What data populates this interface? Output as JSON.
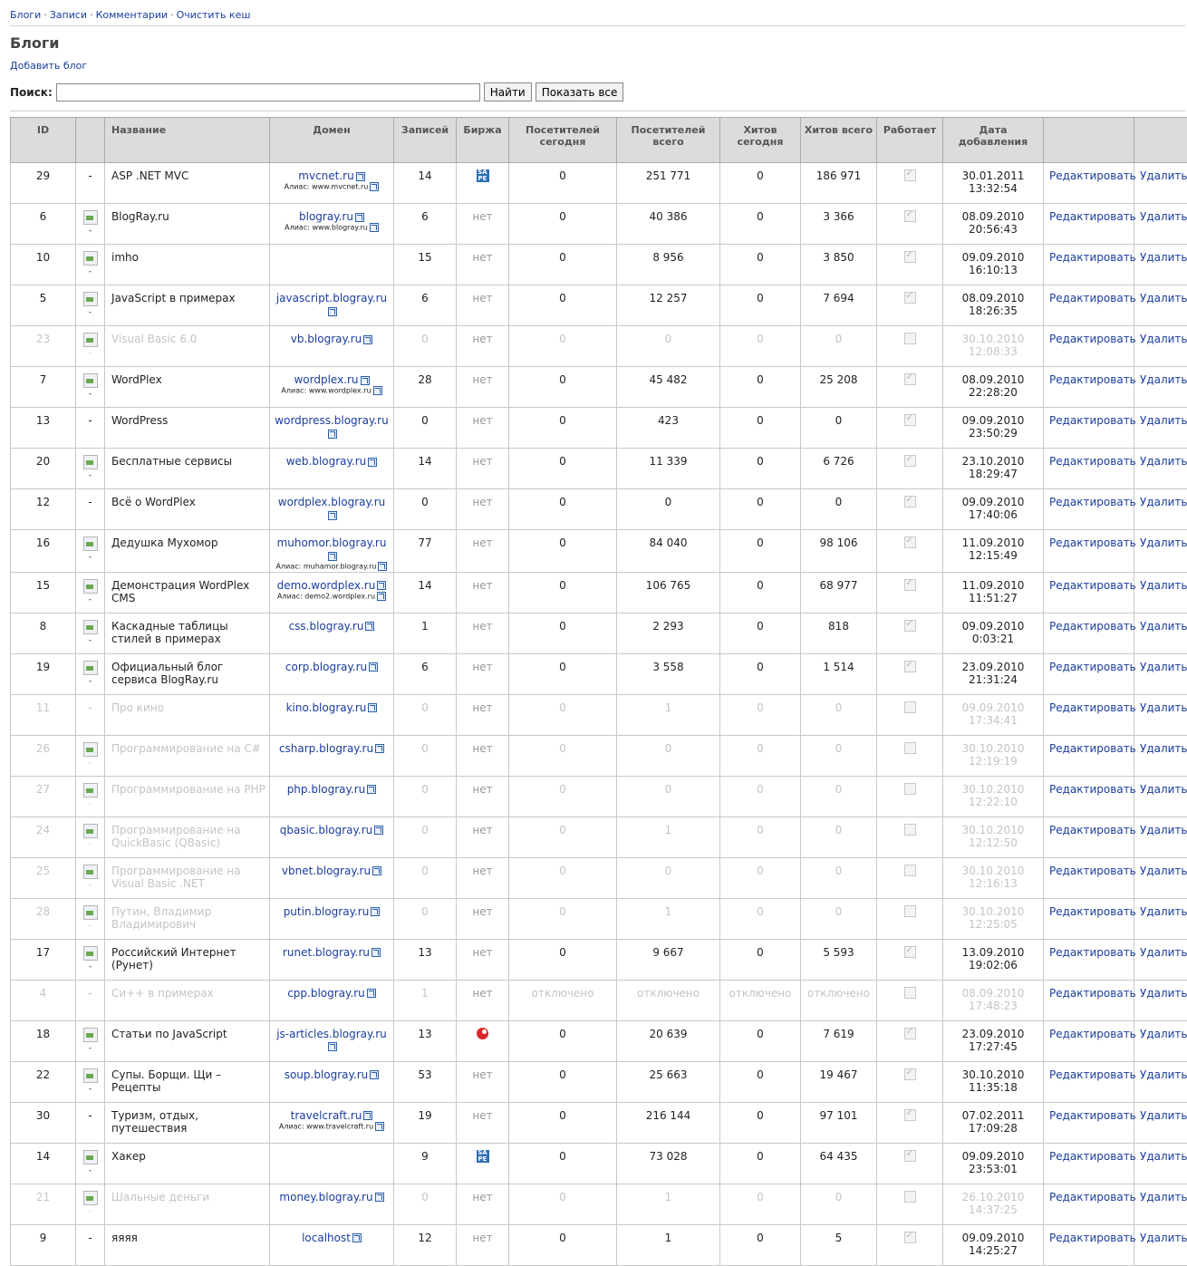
{
  "nav": {
    "items": [
      "Блоги",
      "Записи",
      "Комментарии",
      "Очистить кеш"
    ],
    "separator": "·"
  },
  "page_title": "Блоги",
  "add_link": "Добавить блог",
  "search": {
    "label": "Поиск:",
    "value": "",
    "find_button": "Найти",
    "show_all_button": "Показать все"
  },
  "columns": [
    "ID",
    "",
    "Название",
    "Домен",
    "Записей",
    "Биржа",
    "Посетителей сегодня",
    "Посетителей всего",
    "Хитов сегодня",
    "Хитов всего",
    "Работает",
    "Дата добавления",
    "",
    ""
  ],
  "action_labels": {
    "edit": "Редактировать",
    "delete": "Удалить"
  },
  "exchange_none": "нет",
  "colors": {
    "link": "#1a3d9e",
    "header_bg": "#dcdcdc",
    "disabled_text": "#c4c4c4"
  },
  "rows": [
    {
      "id": "29",
      "icon": "-",
      "name": "ASP .NET MVC",
      "domain": "mvcnet.ru",
      "alias": "Алиас: www.mvcnet.ru",
      "posts": "14",
      "exchange": "sape",
      "visitors_today": "0",
      "visitors_total": "251 771",
      "hits_today": "0",
      "hits_total": "186 971",
      "works": true,
      "date": "30.01.2011",
      "time": "13:32:54",
      "disabled": false
    },
    {
      "id": "6",
      "icon": "img",
      "name": "BlogRay.ru",
      "domain": "blogray.ru",
      "alias": "Алиас: www.blogray.ru",
      "posts": "6",
      "exchange": "нет",
      "visitors_today": "0",
      "visitors_total": "40 386",
      "hits_today": "0",
      "hits_total": "3 366",
      "works": true,
      "date": "08.09.2010",
      "time": "20:56:43",
      "disabled": false
    },
    {
      "id": "10",
      "icon": "img",
      "name": "imho",
      "domain": "",
      "alias": "",
      "posts": "15",
      "exchange": "нет",
      "visitors_today": "0",
      "visitors_total": "8 956",
      "hits_today": "0",
      "hits_total": "3 850",
      "works": true,
      "date": "09.09.2010",
      "time": "16:10:13",
      "disabled": false
    },
    {
      "id": "5",
      "icon": "img",
      "name": "JavaScript в примерах",
      "domain": "javascript.blogray.ru",
      "alias": "",
      "posts": "6",
      "exchange": "нет",
      "visitors_today": "0",
      "visitors_total": "12 257",
      "hits_today": "0",
      "hits_total": "7 694",
      "works": true,
      "date": "08.09.2010",
      "time": "18:26:35",
      "disabled": false
    },
    {
      "id": "23",
      "icon": "img",
      "name": "Visual Basic 6.0",
      "domain": "vb.blogray.ru",
      "alias": "",
      "posts": "0",
      "exchange": "нет",
      "visitors_today": "0",
      "visitors_total": "0",
      "hits_today": "0",
      "hits_total": "0",
      "works": false,
      "date": "30.10.2010",
      "time": "12:08:33",
      "disabled": true
    },
    {
      "id": "7",
      "icon": "img",
      "name": "WordPlex",
      "domain": "wordplex.ru",
      "alias": "Алиас: www.wordplex.ru",
      "posts": "28",
      "exchange": "нет",
      "visitors_today": "0",
      "visitors_total": "45 482",
      "hits_today": "0",
      "hits_total": "25 208",
      "works": true,
      "date": "08.09.2010",
      "time": "22:28:20",
      "disabled": false
    },
    {
      "id": "13",
      "icon": "-",
      "name": "WordPress",
      "domain": "wordpress.blogray.ru",
      "alias": "",
      "posts": "0",
      "exchange": "нет",
      "visitors_today": "0",
      "visitors_total": "423",
      "hits_today": "0",
      "hits_total": "0",
      "works": true,
      "date": "09.09.2010",
      "time": "23:50:29",
      "disabled": false
    },
    {
      "id": "20",
      "icon": "img",
      "name": "Бесплатные сервисы",
      "domain": "web.blogray.ru",
      "alias": "",
      "posts": "14",
      "exchange": "нет",
      "visitors_today": "0",
      "visitors_total": "11 339",
      "hits_today": "0",
      "hits_total": "6 726",
      "works": true,
      "date": "23.10.2010",
      "time": "18:29:47",
      "disabled": false
    },
    {
      "id": "12",
      "icon": "-",
      "name": "Всё о WordPlex",
      "domain": "wordplex.blogray.ru",
      "alias": "",
      "posts": "0",
      "exchange": "нет",
      "visitors_today": "0",
      "visitors_total": "0",
      "hits_today": "0",
      "hits_total": "0",
      "works": true,
      "date": "09.09.2010",
      "time": "17:40:06",
      "disabled": false
    },
    {
      "id": "16",
      "icon": "img",
      "name": "Дедушка Мухомор",
      "domain": "muhomor.blogray.ru",
      "alias": "Алиас: muhamor.blogray.ru",
      "posts": "77",
      "exchange": "нет",
      "visitors_today": "0",
      "visitors_total": "84 040",
      "hits_today": "0",
      "hits_total": "98 106",
      "works": true,
      "date": "11.09.2010",
      "time": "12:15:49",
      "disabled": false
    },
    {
      "id": "15",
      "icon": "img",
      "name": "Демонстрация WordPlex CMS",
      "domain": "demo.wordplex.ru",
      "alias": "Алиас: demo2.wordplex.ru",
      "posts": "14",
      "exchange": "нет",
      "visitors_today": "0",
      "visitors_total": "106 765",
      "hits_today": "0",
      "hits_total": "68 977",
      "works": true,
      "date": "11.09.2010",
      "time": "11:51:27",
      "disabled": false
    },
    {
      "id": "8",
      "icon": "img",
      "name": "Каскадные таблицы стилей в примерах",
      "domain": "css.blogray.ru",
      "alias": "",
      "posts": "1",
      "exchange": "нет",
      "visitors_today": "0",
      "visitors_total": "2 293",
      "hits_today": "0",
      "hits_total": "818",
      "works": true,
      "date": "09.09.2010",
      "time": "0:03:21",
      "disabled": false
    },
    {
      "id": "19",
      "icon": "img",
      "name": "Официальный блог сервиса BlogRay.ru",
      "domain": "corp.blogray.ru",
      "alias": "",
      "posts": "6",
      "exchange": "нет",
      "visitors_today": "0",
      "visitors_total": "3 558",
      "hits_today": "0",
      "hits_total": "1 514",
      "works": true,
      "date": "23.09.2010",
      "time": "21:31:24",
      "disabled": false
    },
    {
      "id": "11",
      "icon": "-",
      "name": "Про кино",
      "domain": "kino.blogray.ru",
      "alias": "",
      "posts": "0",
      "exchange": "нет",
      "visitors_today": "0",
      "visitors_total": "1",
      "hits_today": "0",
      "hits_total": "0",
      "works": false,
      "date": "09.09.2010",
      "time": "17:34:41",
      "disabled": true
    },
    {
      "id": "26",
      "icon": "img",
      "name": "Программирование на C#",
      "domain": "csharp.blogray.ru",
      "alias": "",
      "posts": "0",
      "exchange": "нет",
      "visitors_today": "0",
      "visitors_total": "0",
      "hits_today": "0",
      "hits_total": "0",
      "works": false,
      "date": "30.10.2010",
      "time": "12:19:19",
      "disabled": true
    },
    {
      "id": "27",
      "icon": "img",
      "name": "Программирование на PHP",
      "domain": "php.blogray.ru",
      "alias": "",
      "posts": "0",
      "exchange": "нет",
      "visitors_today": "0",
      "visitors_total": "0",
      "hits_today": "0",
      "hits_total": "0",
      "works": false,
      "date": "30.10.2010",
      "time": "12:22:10",
      "disabled": true
    },
    {
      "id": "24",
      "icon": "img",
      "name": "Программирование на QuickBasic (QBasic)",
      "domain": "qbasic.blogray.ru",
      "alias": "",
      "posts": "0",
      "exchange": "нет",
      "visitors_today": "0",
      "visitors_total": "1",
      "hits_today": "0",
      "hits_total": "0",
      "works": false,
      "date": "30.10.2010",
      "time": "12:12:50",
      "disabled": true
    },
    {
      "id": "25",
      "icon": "img",
      "name": "Программирование на Visual Basic .NET",
      "domain": "vbnet.blogray.ru",
      "alias": "",
      "posts": "0",
      "exchange": "нет",
      "visitors_today": "0",
      "visitors_total": "0",
      "hits_today": "0",
      "hits_total": "0",
      "works": false,
      "date": "30.10.2010",
      "time": "12:16:13",
      "disabled": true
    },
    {
      "id": "28",
      "icon": "img",
      "name": "Путин, Владимир Владимирович",
      "domain": "putin.blogray.ru",
      "alias": "",
      "posts": "0",
      "exchange": "нет",
      "visitors_today": "0",
      "visitors_total": "1",
      "hits_today": "0",
      "hits_total": "0",
      "works": false,
      "date": "30.10.2010",
      "time": "12:25:05",
      "disabled": true
    },
    {
      "id": "17",
      "icon": "img",
      "name": "Российский Интернет (Рунет)",
      "domain": "runet.blogray.ru",
      "alias": "",
      "posts": "13",
      "exchange": "нет",
      "visitors_today": "0",
      "visitors_total": "9 667",
      "hits_today": "0",
      "hits_total": "5 593",
      "works": true,
      "date": "13.09.2010",
      "time": "19:02:06",
      "disabled": false
    },
    {
      "id": "4",
      "icon": "-",
      "name": "Си++ в примерах",
      "domain": "cpp.blogray.ru",
      "alias": "",
      "posts": "1",
      "exchange": "нет",
      "visitors_today": "отключено",
      "visitors_total": "отключено",
      "hits_today": "отключено",
      "hits_total": "отключено",
      "works": false,
      "date": "08.09.2010",
      "time": "17:48:23",
      "disabled": true
    },
    {
      "id": "18",
      "icon": "img",
      "name": "Статьи по JavaScript",
      "domain": "js-articles.blogray.ru",
      "alias": "",
      "posts": "13",
      "exchange": "liveinternet",
      "visitors_today": "0",
      "visitors_total": "20 639",
      "hits_today": "0",
      "hits_total": "7 619",
      "works": true,
      "date": "23.09.2010",
      "time": "17:27:45",
      "disabled": false
    },
    {
      "id": "22",
      "icon": "img",
      "name": "Супы. Борщи. Щи – Рецепты",
      "domain": "soup.blogray.ru",
      "alias": "",
      "posts": "53",
      "exchange": "нет",
      "visitors_today": "0",
      "visitors_total": "25 663",
      "hits_today": "0",
      "hits_total": "19 467",
      "works": true,
      "date": "30.10.2010",
      "time": "11:35:18",
      "disabled": false
    },
    {
      "id": "30",
      "icon": "-",
      "name": "Туризм, отдых, путешествия",
      "domain": "travelcraft.ru",
      "alias": "Алиас: www.travelcraft.ru",
      "posts": "19",
      "exchange": "нет",
      "visitors_today": "0",
      "visitors_total": "216 144",
      "hits_today": "0",
      "hits_total": "97 101",
      "works": true,
      "date": "07.02.2011",
      "time": "17:09:28",
      "disabled": false
    },
    {
      "id": "14",
      "icon": "img",
      "name": "Хакер",
      "domain": "",
      "alias": "",
      "posts": "9",
      "exchange": "sape",
      "visitors_today": "0",
      "visitors_total": "73 028",
      "hits_today": "0",
      "hits_total": "64 435",
      "works": true,
      "date": "09.09.2010",
      "time": "23:53:01",
      "disabled": false
    },
    {
      "id": "21",
      "icon": "img",
      "name": "Шальные деньги",
      "domain": "money.blogray.ru",
      "alias": "",
      "posts": "0",
      "exchange": "нет",
      "visitors_today": "0",
      "visitors_total": "1",
      "hits_today": "0",
      "hits_total": "0",
      "works": false,
      "date": "26.10.2010",
      "time": "14:37:25",
      "disabled": true
    },
    {
      "id": "9",
      "icon": "-",
      "name": "яяяя",
      "domain": "localhost",
      "alias": "",
      "posts": "12",
      "exchange": "нет",
      "visitors_today": "0",
      "visitors_total": "1",
      "hits_today": "0",
      "hits_total": "5",
      "works": true,
      "date": "09.09.2010",
      "time": "14:25:27",
      "disabled": false
    }
  ]
}
